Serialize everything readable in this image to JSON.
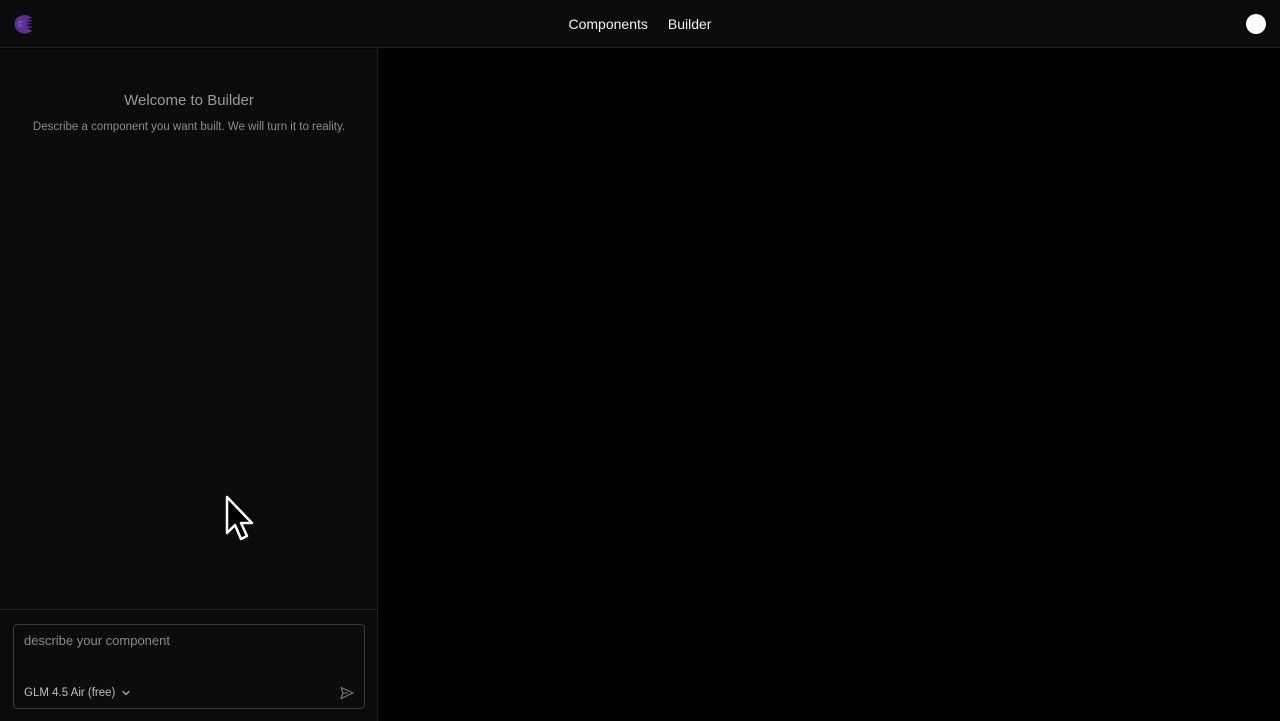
{
  "header": {
    "logo_icon": "brand-logo-icon",
    "nav": [
      {
        "label": "Components"
      },
      {
        "label": "Builder"
      }
    ],
    "avatar_icon": "user-avatar"
  },
  "sidebar": {
    "welcome_title": "Welcome to Builder",
    "welcome_subtitle": "Describe a component you want built. We will turn it to reality.",
    "composer": {
      "placeholder": "describe your component",
      "value": "",
      "model_label": "GLM 4.5 Air (free)",
      "model_icon": "chevron-down-icon",
      "send_icon": "send-icon"
    }
  },
  "colors": {
    "accent": "#6b3fa0",
    "background": "#000000",
    "panel": "#0b0b0b"
  }
}
